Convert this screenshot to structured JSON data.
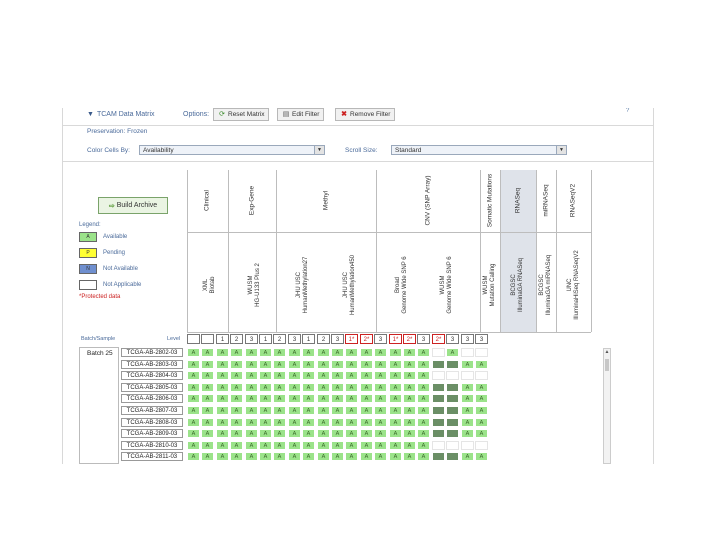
{
  "toolbar": {
    "title": "TCAM Data Matrix",
    "options_label": "Options:",
    "reset_label": "Reset Matrix",
    "edit_label": "Edit Filter",
    "remove_label": "Remove Filter",
    "help_label": "?"
  },
  "preservation": {
    "label": "Preservation:",
    "value": "Frozen"
  },
  "color_by": {
    "label": "Color Cells By:",
    "value": "Availability"
  },
  "scroll_size": {
    "label": "Scroll Size:",
    "value": "Standard"
  },
  "build_archive_label": "Build Archive",
  "legend": {
    "title": "Legend:",
    "items": [
      {
        "box": "A",
        "label": "Available",
        "color": "#9be38a"
      },
      {
        "box": "P",
        "label": "Pending",
        "color": "#ffff33"
      },
      {
        "box": "N",
        "label": "Not Available",
        "color": "#6f8fcf"
      },
      {
        "box": "",
        "label": "Not Applicable",
        "color": "#ffffff"
      }
    ],
    "protected": "*Protected data"
  },
  "groups": [
    "Clinical",
    "Exp-Gene",
    "Methyl",
    "CNV (SNP Array)",
    "Somatic Mutations",
    "RNASeq",
    "miRNASeq",
    "RNASeqV2"
  ],
  "platforms": [
    {
      "line1": "XML",
      "line2": "Biotab"
    },
    {
      "line1": "WUSM",
      "line2": "HG-U133 Plus 2"
    },
    {
      "line1": "JHU USC",
      "line2": "HumanMethylation27"
    },
    {
      "line1": "JHU USC",
      "line2": "HumanMethylation450"
    },
    {
      "line1": "Broad",
      "line2": "Genome Wide SNP 6"
    },
    {
      "line1": "WUSM",
      "line2": "Genome Wide SNP 6"
    },
    {
      "line1": "WUSM",
      "line2": "Mutation Calling"
    },
    {
      "line1": "BCGSC",
      "line2": "IlluminaGA RNASeq"
    },
    {
      "line1": "BCGSC",
      "line2": "IlluminaGA miRNASeq"
    },
    {
      "line1": "UNC",
      "line2": "IlluminaHiSeq RNASeqV2"
    }
  ],
  "levels": [
    "",
    "",
    "1",
    "2",
    "3",
    "1",
    "2",
    "3",
    "1",
    "2",
    "3",
    "1*",
    "2*",
    "3",
    "1*",
    "2*",
    "3",
    "2*",
    "3",
    "3",
    "3"
  ],
  "labels": {
    "batch_sample": "Batch/Sample",
    "levels": "Level"
  },
  "batch": "Batch 25",
  "samples": [
    "TCGA-AB-2802-03",
    "TCGA-AB-2803-03",
    "TCGA-AB-2804-03",
    "TCGA-AB-2805-03",
    "TCGA-AB-2806-03",
    "TCGA-AB-2807-03",
    "TCGA-AB-2808-03",
    "TCGA-AB-2809-03",
    "TCGA-AB-2810-03",
    "TCGA-AB-2811-03"
  ],
  "cell_symbol": "A",
  "matrix": [
    "AAAAAAAAAAAAAAAAAEAEE",
    "AAAAAAAAAAAAAAAAADDAA",
    "AAAAAAAAAAAAAAAAAEEEE",
    "AAAAAAAAAAAAAAAAADDAA",
    "AAAAAAAAAAAAAAAAADDAA",
    "AAAAAAAAAAAAAAAAADDAA",
    "AAAAAAAAAAAAAAAAADDAA",
    "AAAAAAAAAAAAAAAAADDAA",
    "AAAAAAAAAAAAAAAAAEEEE",
    "AAAAAAAAAAAAAAAAADDAA"
  ]
}
